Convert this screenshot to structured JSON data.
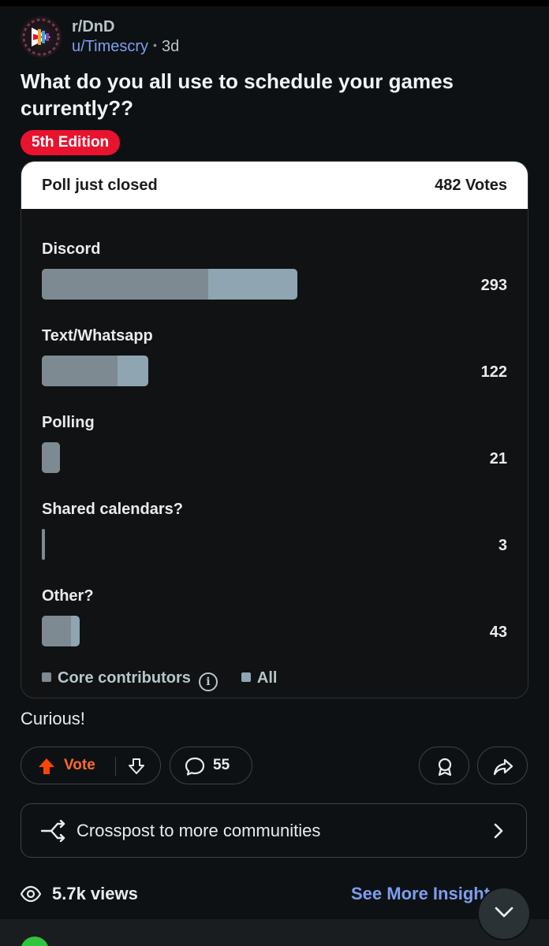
{
  "post": {
    "subreddit": "r/DnD",
    "author": "u/Timescry",
    "age": "3d",
    "title": "What do you all use to schedule your games currently??",
    "flair": "5th Edition",
    "body": "Curious!"
  },
  "poll": {
    "status": "Poll just closed",
    "total_votes_label": "482 Votes",
    "legend_core": "Core contributors",
    "legend_all": "All",
    "colors": {
      "all_votes": "#8fa5b1",
      "core_contributors": "#7d8a91"
    },
    "options": [
      {
        "label": "Discord",
        "votes": "293",
        "votes_value": 293,
        "core_fraction": 0.65
      },
      {
        "label": "Text/Whatsapp",
        "votes": "122",
        "votes_value": 122,
        "core_fraction": 0.71
      },
      {
        "label": "Polling",
        "votes": "21",
        "votes_value": 21,
        "core_fraction": 1.0
      },
      {
        "label": "Shared calendars?",
        "votes": "3",
        "votes_value": 3,
        "core_fraction": 1.0
      },
      {
        "label": "Other?",
        "votes": "43",
        "votes_value": 43,
        "core_fraction": 0.78
      }
    ]
  },
  "actions": {
    "vote_label": "Vote",
    "comment_count": "55",
    "upvote_icon": "upvote-arrow-icon",
    "downvote_icon": "downvote-arrow-icon",
    "comment_icon": "comment-bubble-icon",
    "award_icon": "award-icon",
    "share_icon": "share-icon"
  },
  "crosspost": {
    "label": "Crosspost to more communities"
  },
  "insights": {
    "views": "5.7k views",
    "see_more": "See More Insights"
  },
  "theme": {
    "accent_orange": "#ff6a2c",
    "link_blue": "#7c9ef0",
    "flair_red": "#e8132e"
  }
}
